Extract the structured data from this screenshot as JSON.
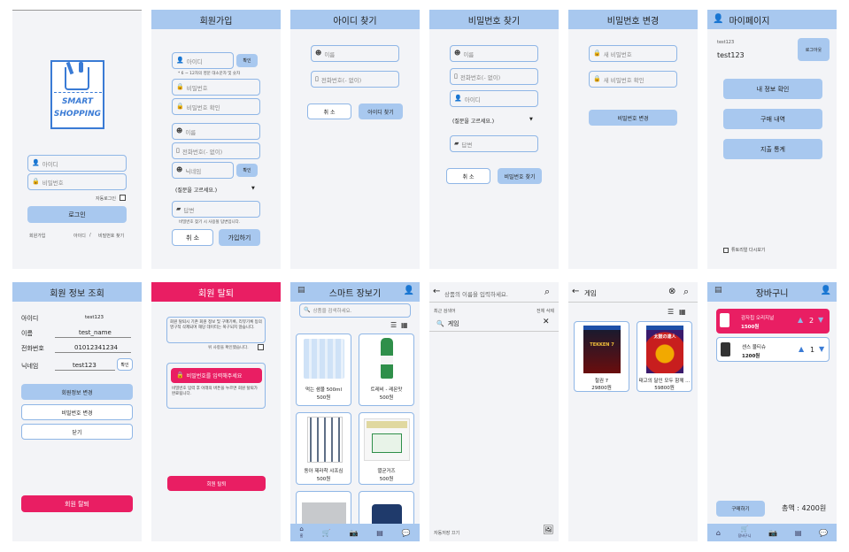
{
  "login": {
    "logo_line1": "SMART",
    "logo_line2": "SHOPPING",
    "id_placeholder": "아이디",
    "pw_placeholder": "비밀번호",
    "auto_login": "자동로그인",
    "login_button": "로그인",
    "signup_link": "회원가입",
    "find_id_link": "아이디",
    "sep": "/",
    "find_pw_link": "비밀번호 찾기"
  },
  "signup": {
    "title": "회원가입",
    "id_placeholder": "아이디",
    "check_button": "확인",
    "id_hint": "* 6 ~ 12자의 영문 대소문자 및 숫자",
    "pw_placeholder": "비밀번호",
    "pw_confirm_placeholder": "비밀번호 확인",
    "name_placeholder": "이름",
    "phone_placeholder": "전화번호(- 없이)",
    "nick_placeholder": "닉네임",
    "nick_check_button": "확인",
    "question_select": "(질문을 고르세요.)",
    "answer_placeholder": "답변",
    "answer_hint": "비밀번호 찾기 시 사용될 답변입니다.",
    "cancel_button": "취 소",
    "join_button": "가입하기"
  },
  "find_id": {
    "title": "아이디 찾기",
    "name_placeholder": "이름",
    "phone_placeholder": "전화번호(- 없이)",
    "cancel_button": "취 소",
    "find_button": "아이디 찾기"
  },
  "find_pw": {
    "title": "비밀번호 찾기",
    "name_placeholder": "이름",
    "phone_placeholder": "전화번호(- 없이)",
    "id_placeholder": "아이디",
    "question_select": "(질문을 고르세요.)",
    "answer_placeholder": "답변",
    "cancel_button": "취 소",
    "find_button": "비밀번호 찾기"
  },
  "change_pw": {
    "title": "비밀번호 변경",
    "new_pw_placeholder": "새 비밀번호",
    "new_pw_confirm_placeholder": "새 비밀번호 확인",
    "change_button": "비밀번호 변경"
  },
  "mypage": {
    "title": "마이페이지",
    "user_small": "test123",
    "user_name": "test123",
    "logout_button": "로그아웃",
    "my_info_button": "내 정보 확인",
    "purchase_button": "구매 내역",
    "stats_button": "지출 통계",
    "tutorial_link": "튜토리얼 다시보기"
  },
  "member_info": {
    "title": "회원 정보 조회",
    "id_label": "아이디",
    "id_value": "test123",
    "name_label": "이름",
    "name_value": "test_name",
    "phone_label": "전화번호",
    "phone_value": "01012341234",
    "nick_label": "닉네임",
    "nick_value": "test123",
    "nick_check_button": "확인",
    "edit_button": "회원정보 변경",
    "pw_change_button": "비밀번호 변경",
    "close_button": "닫기",
    "withdraw_button": "회원 탈퇴"
  },
  "withdraw": {
    "title": "회원 탈퇴",
    "notice": "회원 탈퇴시 기존 회원 정보 및 구매기록, 리뷰기록 등의 영구적 삭제되며 해당 데이터는 복구되지 않습니다.",
    "confirm_label": "위 사항을 확인했습니다.",
    "pw_button": "비밀번호를 입력해주세요",
    "pw_hint": "비밀번호 입력 후 아래의 버튼을 누르면 회원 탈퇴가 완료됩니다.",
    "withdraw_button": "회원 탈퇴"
  },
  "smart_shopping": {
    "title": "스마트 장보기",
    "search_placeholder": "상품을 검색하세요.",
    "products": [
      {
        "name": "먹는 샘물 500ml",
        "price": "500원"
      },
      {
        "name": "트레비 - 레몬맛",
        "price": "500원"
      },
      {
        "name": "동아 제라착 샤프심",
        "price": "500원"
      },
      {
        "name": "멸균거즈",
        "price": "500원"
      }
    ]
  },
  "search_page": {
    "placeholder": "상품의 이름을 입력하세요.",
    "recent_label": "최근 검색어",
    "delete_all": "전체 삭제",
    "recent_item": "게임",
    "auto_save_off": "자동저장 끄기"
  },
  "search_result": {
    "query": "게임",
    "results": [
      {
        "name": "철권 7",
        "price": "29800원",
        "art": "TEKKEN 7"
      },
      {
        "name": "태고의 달인 모두 함께 ...",
        "price": "59800원",
        "art": "太鼓の達人"
      }
    ]
  },
  "cart": {
    "title": "장바구니",
    "items": [
      {
        "name": "감자칩 오리지널",
        "price": "1500원",
        "qty": "2"
      },
      {
        "name": "센스 물티슈",
        "price": "1200원",
        "qty": "1"
      }
    ],
    "buy_button": "구매하기",
    "total_label": "총액 : 4200원",
    "nav_cart_label": "장바구니"
  },
  "nav_home_label": "홈",
  "colors": {
    "header_blue": "#a8c8ef",
    "accent_pink": "#e91e63",
    "input_border": "#8fb6e6",
    "panel_bg": "#f3f4f7"
  }
}
